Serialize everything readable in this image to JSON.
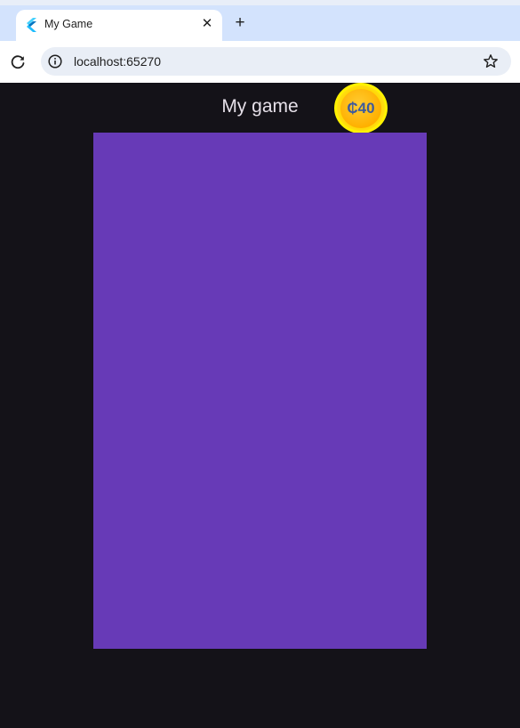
{
  "browser": {
    "tab": {
      "title": "My Game",
      "favicon": "flutter-icon",
      "close_glyph": "✕"
    },
    "new_tab_glyph": "+",
    "toolbar": {
      "reload_icon": "reload-icon",
      "site_info_icon": "info-icon",
      "url": "localhost:65270",
      "bookmark_icon": "star-icon"
    }
  },
  "game": {
    "title": "My game",
    "coin": {
      "label": "₵40"
    },
    "colors": {
      "background": "#141218",
      "board": "#673ab7",
      "coin": "#ffc107",
      "coin_text": "#3d5a9c"
    }
  }
}
